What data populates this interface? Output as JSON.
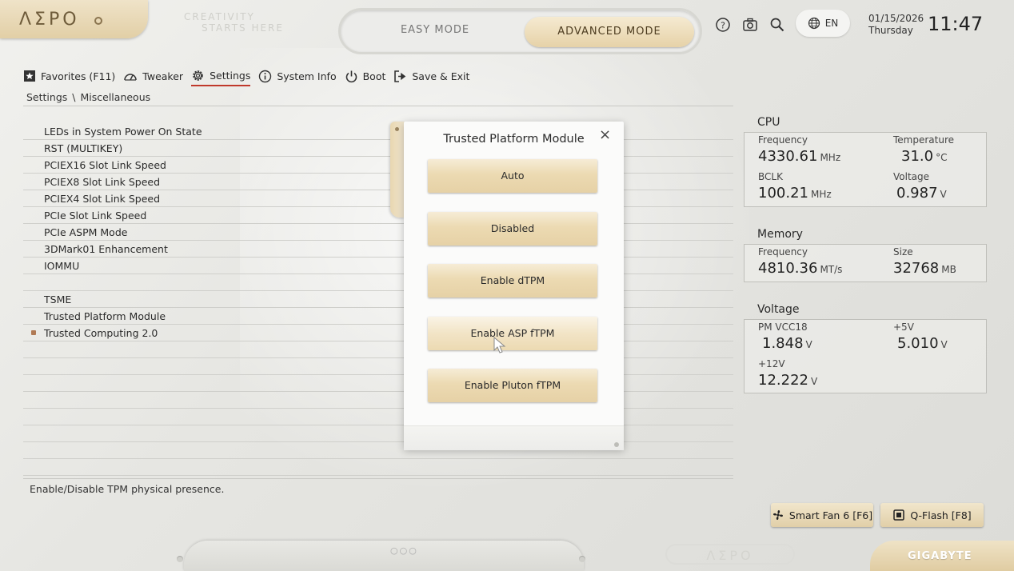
{
  "header": {
    "logo": "ΛΣΡΟ",
    "slogan_line1": "CREATIVITY",
    "slogan_line2": "STARTS HERE",
    "mode_easy": "EASY MODE",
    "mode_advanced": "ADVANCED MODE",
    "language": "EN",
    "date": "01/15/2026",
    "weekday": "Thursday",
    "time": "11:47"
  },
  "nav": {
    "favorites": "Favorites (F11)",
    "tweaker": "Tweaker",
    "settings": "Settings",
    "system_info": "System Info",
    "boot": "Boot",
    "save_exit": "Save & Exit"
  },
  "breadcrumb": {
    "root": "Settings",
    "separator": "\\",
    "current": "Miscellaneous"
  },
  "settings_list": [
    "LEDs in System Power On State",
    "RST (MULTIKEY)",
    "PCIEX16 Slot Link Speed",
    "PCIEX8 Slot Link Speed",
    "PCIEX4 Slot Link Speed",
    "PCIe Slot Link Speed",
    "PCIe ASPM Mode",
    "3DMark01 Enhancement",
    "IOMMU",
    "",
    "TSME",
    "Trusted Platform Module",
    "Trusted Computing 2.0"
  ],
  "help_text": "Enable/Disable TPM physical presence.",
  "modal": {
    "title": "Trusted Platform Module",
    "close": "×",
    "options": [
      "Auto",
      "Disabled",
      "Enable dTPM",
      "Enable ASP fTPM",
      "Enable Pluton fTPM"
    ]
  },
  "cpu": {
    "title": "CPU",
    "freq_label": "Frequency",
    "freq_value": "4330.61",
    "freq_unit": "MHz",
    "temp_label": "Temperature",
    "temp_value": "31.0",
    "temp_unit": "°C",
    "bclk_label": "BCLK",
    "bclk_value": "100.21",
    "bclk_unit": "MHz",
    "volt_label": "Voltage",
    "volt_value": "0.987",
    "volt_unit": "V"
  },
  "memory": {
    "title": "Memory",
    "freq_label": "Frequency",
    "freq_value": "4810.36",
    "freq_unit": "MT/s",
    "size_label": "Size",
    "size_value": "32768",
    "size_unit": "MB"
  },
  "voltage": {
    "title": "Voltage",
    "vcc_label": "PM VCC18",
    "vcc_value": "1.848",
    "vcc_unit": "V",
    "v5_label": "+5V",
    "v5_value": "5.010",
    "v5_unit": "V",
    "v12_label": "+12V",
    "v12_value": "12.222",
    "v12_unit": "V"
  },
  "bottom_buttons": {
    "smart_fan": "Smart Fan 6 [F6]",
    "qflash": "Q-Flash [F8]"
  },
  "footer": {
    "aero": "ΛΣΡΟ",
    "brand": "GIGABYTE",
    "dots": "○○○"
  }
}
